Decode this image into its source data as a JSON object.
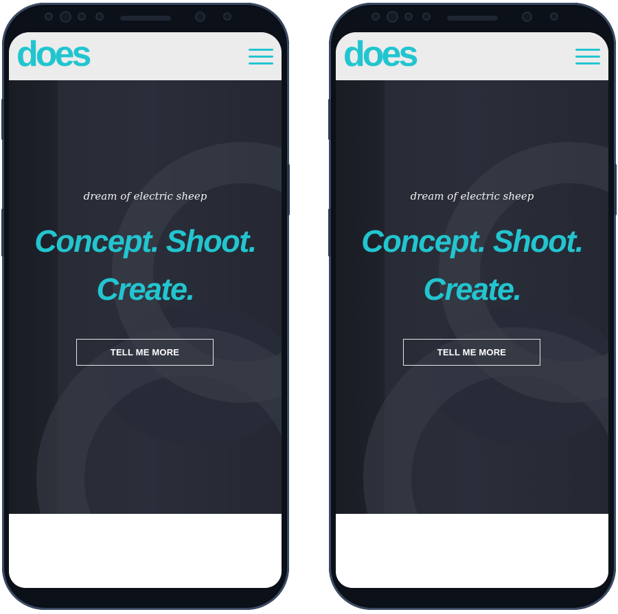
{
  "brand": {
    "logo_text": "does",
    "accent_color": "#22c5cf"
  },
  "header": {
    "menu_icon": "hamburger-menu-icon"
  },
  "hero": {
    "tagline": "dream of electric sheep",
    "headline_line1": "Concept. Shoot.",
    "headline_line2": "Create.",
    "cta_label": "TELL ME MORE"
  }
}
